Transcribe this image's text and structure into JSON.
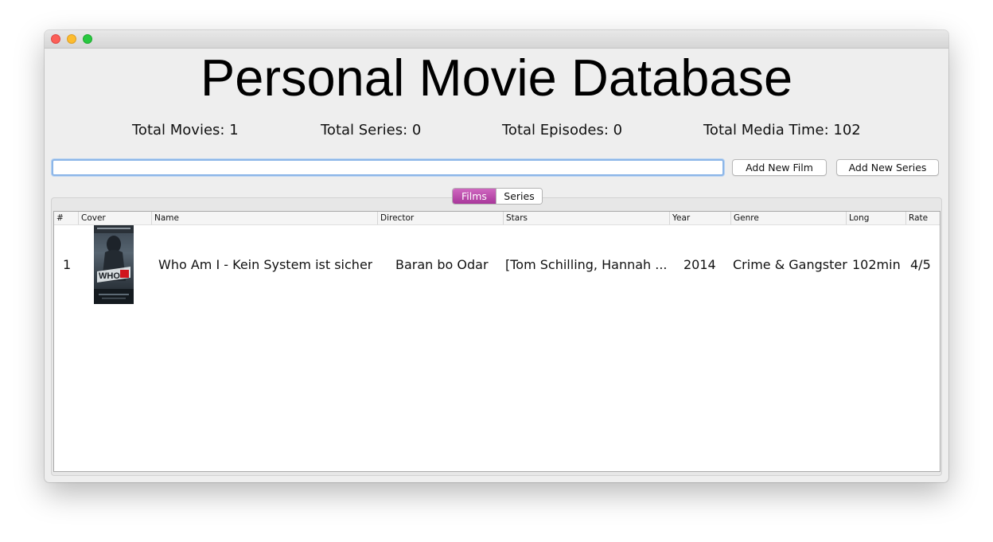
{
  "window": {
    "title": ""
  },
  "header": {
    "title": "Personal Movie Database"
  },
  "stats": {
    "movies": "Total Movies: 1",
    "series": "Total Series: 0",
    "episodes": "Total Episodes: 0",
    "media_time": "Total Media Time: 102"
  },
  "search": {
    "value": "",
    "placeholder": ""
  },
  "toolbar": {
    "add_film_label": "Add New Film",
    "add_series_label": "Add New Series"
  },
  "tabs": [
    {
      "label": "Films",
      "selected": true
    },
    {
      "label": "Series",
      "selected": false
    }
  ],
  "table": {
    "columns": [
      "#",
      "Cover",
      "Name",
      "Director",
      "Stars",
      "Year",
      "Genre",
      "Long",
      "Rate"
    ],
    "rows": [
      {
        "index": "1",
        "cover_icon": "movie-poster",
        "name": "Who Am I - Kein System ist sicher",
        "director": "Baran bo Odar",
        "stars": "[Tom Schilling, Hannah ...",
        "year": "2014",
        "genre": "Crime & Gangster",
        "long": "102min",
        "rate": "4/5"
      }
    ]
  },
  "colors": {
    "accent_tab": "#b544a8",
    "focus_ring": "#8cb6e8",
    "window_bg": "#eeeeee"
  }
}
